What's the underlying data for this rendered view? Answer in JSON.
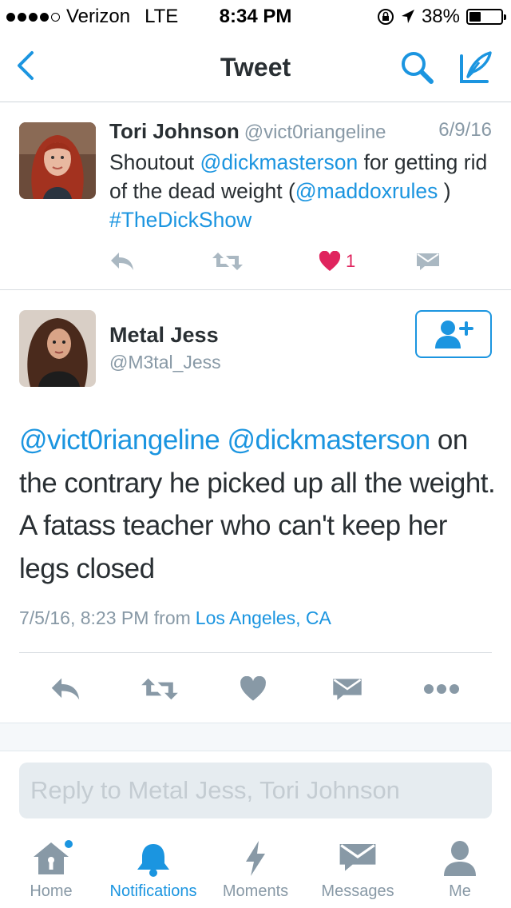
{
  "status_bar": {
    "carrier": "Verizon",
    "network": "LTE",
    "time": "8:34 PM",
    "battery": "38%",
    "battery_level": 0.38
  },
  "nav": {
    "title": "Tweet"
  },
  "tweet1": {
    "name": "Tori Johnson",
    "handle": "@vict0riangeline",
    "date": "6/9/16",
    "text_1": "Shoutout ",
    "mention_1": "@dickmasterson",
    "text_2": " for getting rid of the dead weight (",
    "mention_2": "@maddoxrules",
    "text_3": " ) ",
    "hashtag": "#TheDickShow",
    "like_count": "1"
  },
  "tweet2": {
    "name": "Metal Jess",
    "handle": "@M3tal_Jess",
    "mention_1": "@vict0riangeline",
    "mention_2": "@dickmasterson",
    "text": " on the contrary he picked up all the weight. A fatass teacher who can't keep her legs closed",
    "timestamp": "7/5/16, 8:23 PM from",
    "location": "Los Angeles, CA"
  },
  "reply": {
    "placeholder": "Reply to Metal Jess, Tori Johnson"
  },
  "tabs": [
    {
      "label": "Home",
      "icon": "home-icon"
    },
    {
      "label": "Notifications",
      "icon": "bell-icon"
    },
    {
      "label": "Moments",
      "icon": "lightning-icon"
    },
    {
      "label": "Messages",
      "icon": "envelope-icon"
    },
    {
      "label": "Me",
      "icon": "person-icon"
    }
  ],
  "colors": {
    "accent": "#1b95e0",
    "like": "#e0245e",
    "muted": "#8899a6",
    "text": "#292f33"
  }
}
